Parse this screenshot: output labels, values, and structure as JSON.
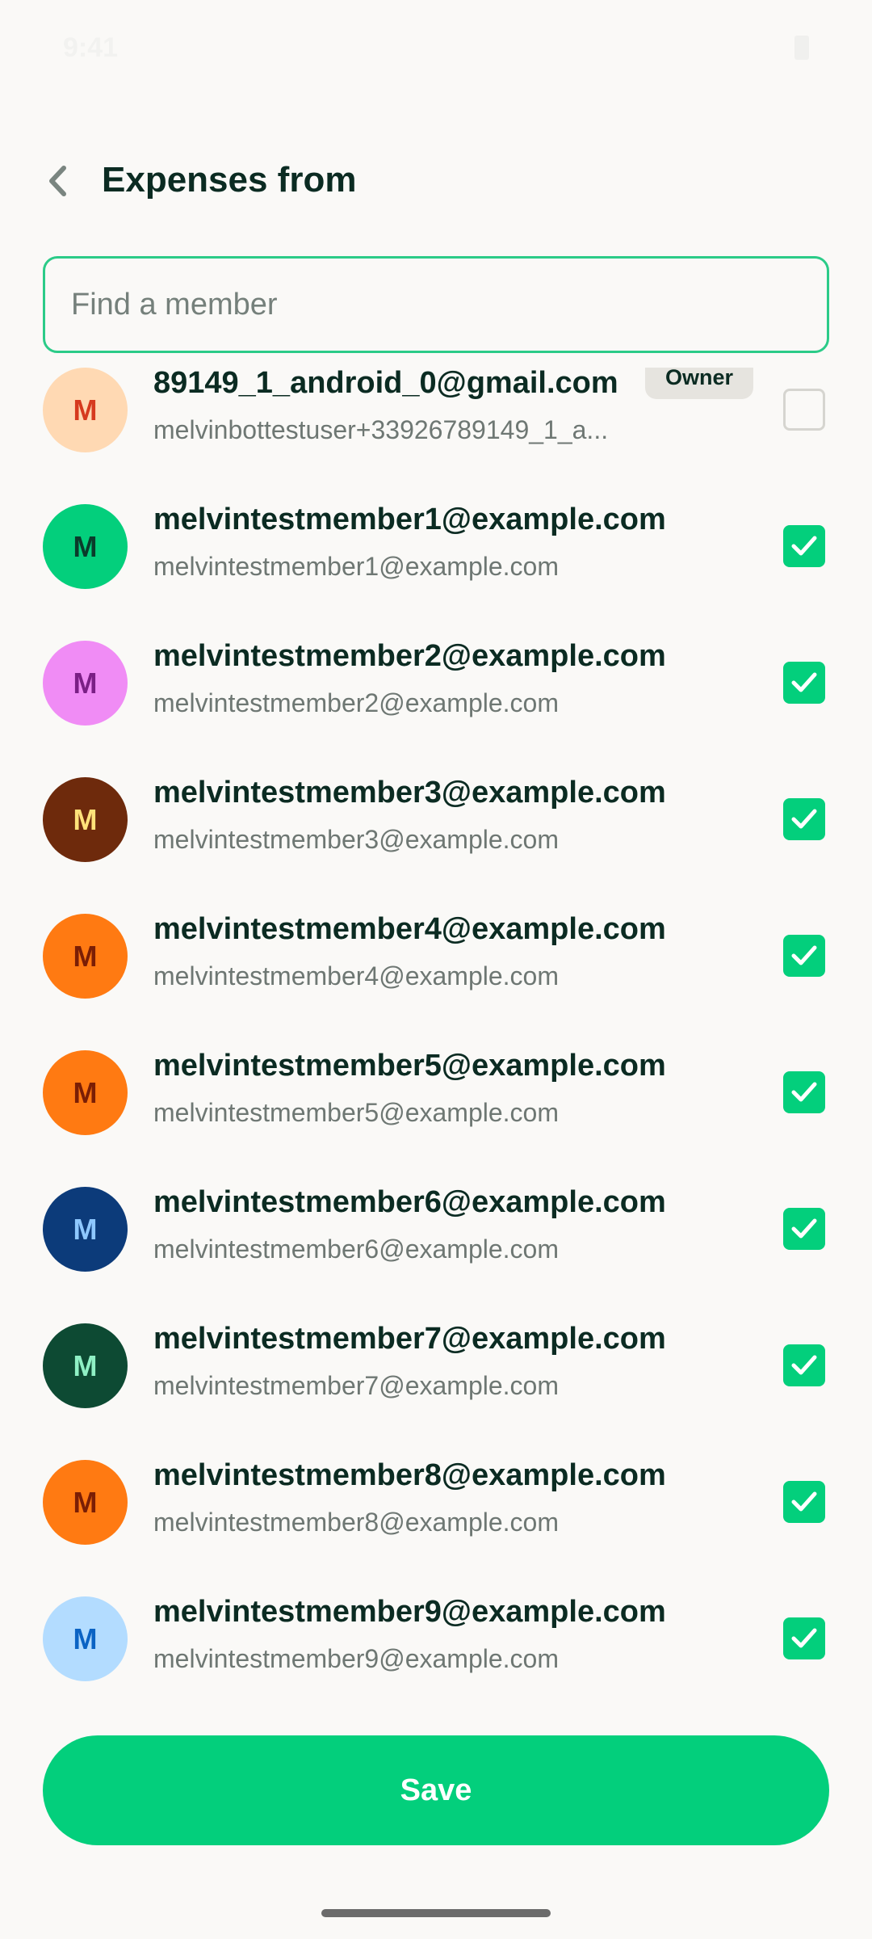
{
  "status_bar": {
    "time": "9:41"
  },
  "header": {
    "title": "Expenses from"
  },
  "search": {
    "placeholder": "Find a member",
    "value": ""
  },
  "members": [
    {
      "name": "89149_1_android_0@gmail.com",
      "email": "melvinbottestuser+33926789149_1_a...",
      "initial": "M",
      "avatar_bg": "#FFD9B3",
      "avatar_fg": "#D63A1E",
      "badge": "Owner",
      "checked": false
    },
    {
      "name": "melvintestmember1@example.com",
      "email": "melvintestmember1@example.com",
      "initial": "M",
      "avatar_bg": "#03CF7C",
      "avatar_fg": "#0B3B2B",
      "checked": true
    },
    {
      "name": "melvintestmember2@example.com",
      "email": "melvintestmember2@example.com",
      "initial": "M",
      "avatar_bg": "#F08CF5",
      "avatar_fg": "#7A1F85",
      "checked": true
    },
    {
      "name": "melvintestmember3@example.com",
      "email": "melvintestmember3@example.com",
      "initial": "M",
      "avatar_bg": "#6E2A0C",
      "avatar_fg": "#FFE27A",
      "checked": true
    },
    {
      "name": "melvintestmember4@example.com",
      "email": "melvintestmember4@example.com",
      "initial": "M",
      "avatar_bg": "#FF7A12",
      "avatar_fg": "#7A1E05",
      "checked": true
    },
    {
      "name": "melvintestmember5@example.com",
      "email": "melvintestmember5@example.com",
      "initial": "M",
      "avatar_bg": "#FF7A12",
      "avatar_fg": "#7A1E05",
      "checked": true
    },
    {
      "name": "melvintestmember6@example.com",
      "email": "melvintestmember6@example.com",
      "initial": "M",
      "avatar_bg": "#0C3B7A",
      "avatar_fg": "#8EC8FF",
      "checked": true
    },
    {
      "name": "melvintestmember7@example.com",
      "email": "melvintestmember7@example.com",
      "initial": "M",
      "avatar_bg": "#0D4A33",
      "avatar_fg": "#8FF0C5",
      "checked": true
    },
    {
      "name": "melvintestmember8@example.com",
      "email": "melvintestmember8@example.com",
      "initial": "M",
      "avatar_bg": "#FF7A12",
      "avatar_fg": "#7A1E05",
      "checked": true
    },
    {
      "name": "melvintestmember9@example.com",
      "email": "melvintestmember9@example.com",
      "initial": "M",
      "avatar_bg": "#B3DCFF",
      "avatar_fg": "#0B63C4",
      "checked": true
    }
  ],
  "footer": {
    "save_label": "Save"
  },
  "colors": {
    "accent": "#03CF7C",
    "text": "#0B2B22",
    "muted": "#6E7773",
    "background": "#FAF9F7"
  }
}
